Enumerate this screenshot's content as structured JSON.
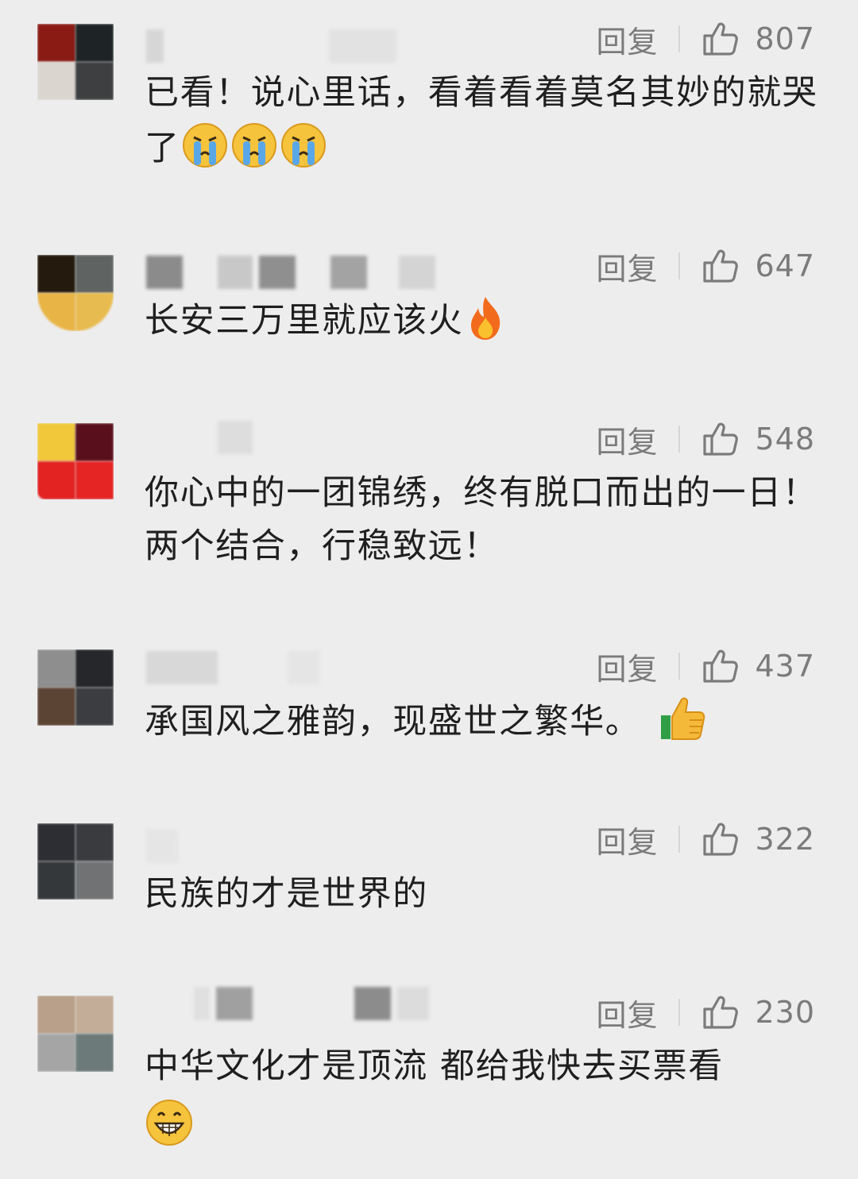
{
  "ui": {
    "reply_label": "回复"
  },
  "comments": [
    {
      "likes": "807",
      "text": "已看！说心里话，看着看着莫名其妙的就哭了",
      "emojis": [
        "crying-emoji",
        "crying-emoji",
        "crying-emoji"
      ]
    },
    {
      "likes": "647",
      "text": "长安三万里就应该火",
      "emojis": [
        "fire-emoji"
      ]
    },
    {
      "likes": "548",
      "text": "你心中的一团锦绣，终有脱口而出的一日！两个结合，行稳致远！",
      "emojis": []
    },
    {
      "likes": "437",
      "text": "承国风之雅韵，现盛世之繁华。",
      "emojis": [
        "thumbs-up-emoji"
      ]
    },
    {
      "likes": "322",
      "text": "民族的才是世界的",
      "emojis": []
    },
    {
      "likes": "230",
      "text": "中华文化才是顶流 都给我快去买票看",
      "emojis": [
        "grinning-emoji"
      ]
    }
  ],
  "colors": {
    "background": "#ededed",
    "meta_text": "#7b7b7b",
    "body_text": "#1f1f1f"
  }
}
